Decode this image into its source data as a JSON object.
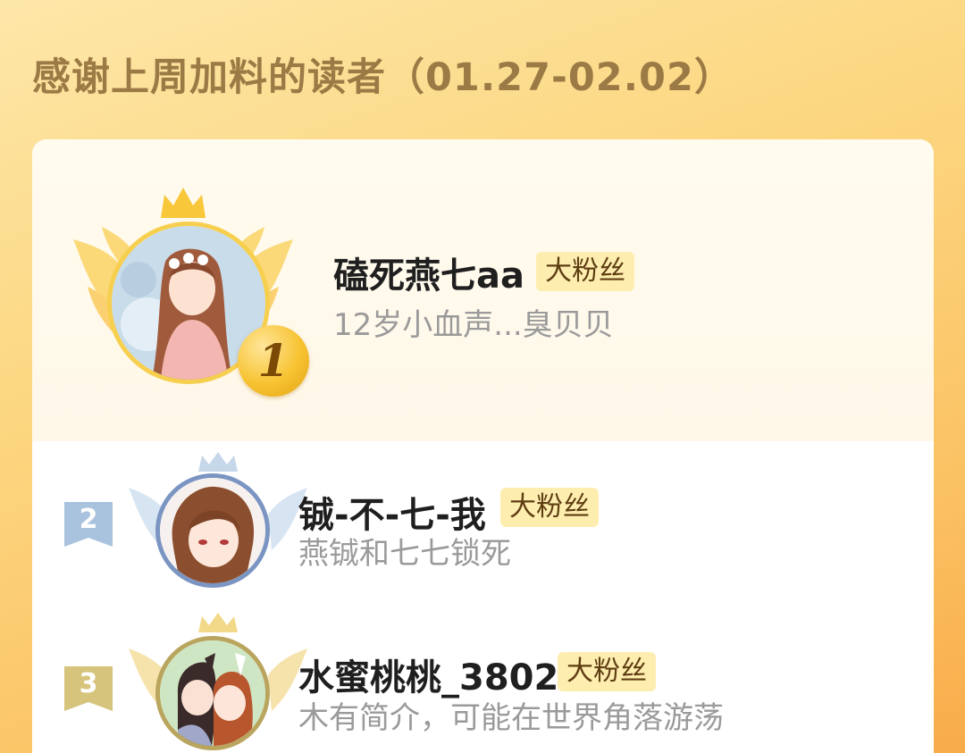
{
  "header": {
    "title": "感谢上周加料的读者（01.27-02.02）"
  },
  "leaderboard": [
    {
      "rank": "1",
      "name": "磕死燕七aa",
      "badge": "大粉丝",
      "bio": "12岁小血声...臭贝贝",
      "avatar_icon": "anime-girl-avatar"
    },
    {
      "rank": "2",
      "name": "铖-不-七-我",
      "badge": "大粉丝",
      "bio": "燕铖和七七锁死",
      "avatar_icon": "anime-boy-avatar"
    },
    {
      "rank": "3",
      "name": "水蜜桃桃_3802",
      "badge": "大粉丝",
      "bio": "木有简介，可能在世界角落游荡",
      "avatar_icon": "anime-couple-avatar"
    }
  ],
  "colors": {
    "gold": "#f7c332",
    "silver": "#a9c2de",
    "bronze": "#d6c37c",
    "title": "#9c7a45"
  }
}
